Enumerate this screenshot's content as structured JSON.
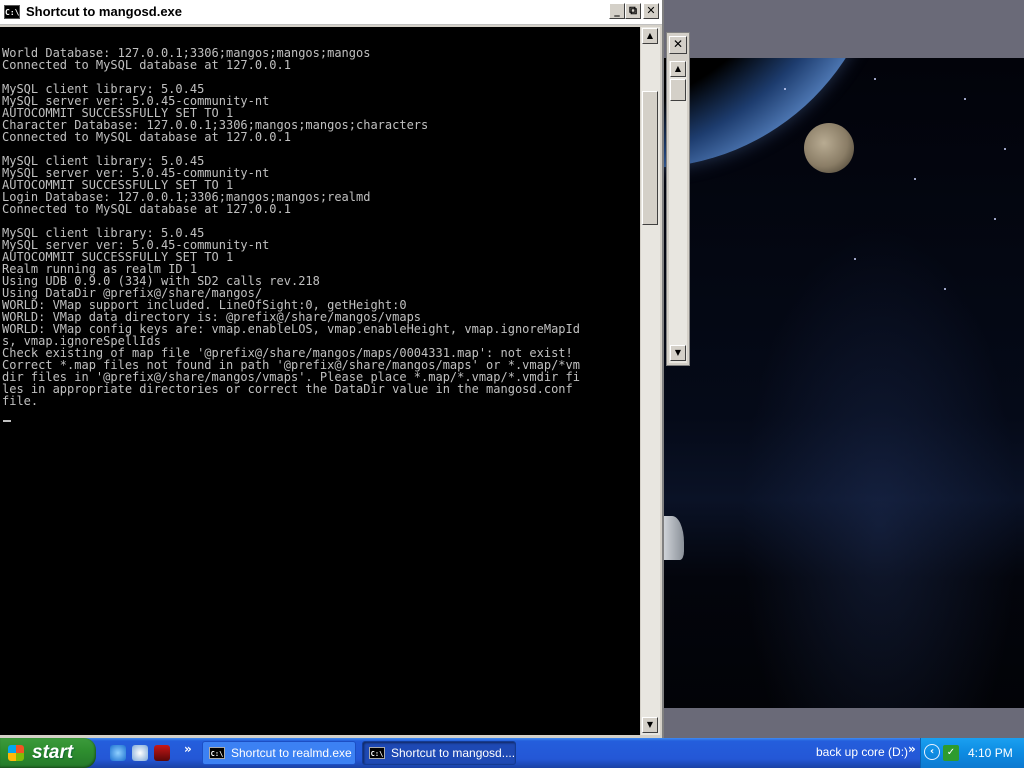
{
  "console_window": {
    "title": "Shortcut to mangosd.exe",
    "icon_text": "C:\\",
    "lines": [
      "World Database: 127.0.0.1;3306;mangos;mangos;mangos",
      "Connected to MySQL database at 127.0.0.1",
      "",
      "MySQL client library: 5.0.45",
      "MySQL server ver: 5.0.45-community-nt",
      "AUTOCOMMIT SUCCESSFULLY SET TO 1",
      "Character Database: 127.0.0.1;3306;mangos;mangos;characters",
      "Connected to MySQL database at 127.0.0.1",
      "",
      "MySQL client library: 5.0.45",
      "MySQL server ver: 5.0.45-community-nt",
      "AUTOCOMMIT SUCCESSFULLY SET TO 1",
      "Login Database: 127.0.0.1;3306;mangos;mangos;realmd",
      "Connected to MySQL database at 127.0.0.1",
      "",
      "MySQL client library: 5.0.45",
      "MySQL server ver: 5.0.45-community-nt",
      "AUTOCOMMIT SUCCESSFULLY SET TO 1",
      "Realm running as realm ID 1",
      "Using UDB 0.9.0 (334) with SD2 calls rev.218",
      "Using DataDir @prefix@/share/mangos/",
      "WORLD: VMap support included. LineOfSight:0, getHeight:0",
      "WORLD: VMap data directory is: @prefix@/share/mangos/vmaps",
      "WORLD: VMap config keys are: vmap.enableLOS, vmap.enableHeight, vmap.ignoreMapIds, vmap.ignoreSpellIds",
      "Check existing of map file '@prefix@/share/mangos/maps/0004331.map': not exist!",
      "Correct *.map files not found in path '@prefix@/share/mangos/maps' or *.vmap/*vmdir files in '@prefix@/share/mangos/vmaps'. Please place *.map/*.vmap/*.vmdir files in appropriate directories or correct the DataDir value in the mangosd.conf file."
    ]
  },
  "buttons": {
    "minimize": "_",
    "maximize": "⧉",
    "close": "✕",
    "scroll_up": "▲",
    "scroll_down": "▼"
  },
  "taskbar": {
    "start_label": "start",
    "tasks": [
      {
        "label": "Shortcut to realmd.exe",
        "icon_text": "C:\\"
      },
      {
        "label": "Shortcut to mangosd....",
        "icon_text": "C:\\"
      }
    ],
    "toolbar_label": "back up core (D:)",
    "chevron": "»",
    "tray_expand": "‹",
    "clock": "4:10 PM"
  },
  "colors": {
    "console_bg": "#000000",
    "console_text": "#c0c0c0",
    "taskbar": "#245edc",
    "start_green": "#2f8f2f",
    "tray": "#0d8be2"
  },
  "icons": [
    "cmd-icon",
    "ie-icon",
    "media-player-icon",
    "app-icon",
    "windows-flag-icon",
    "safely-remove-hardware-icon"
  ]
}
